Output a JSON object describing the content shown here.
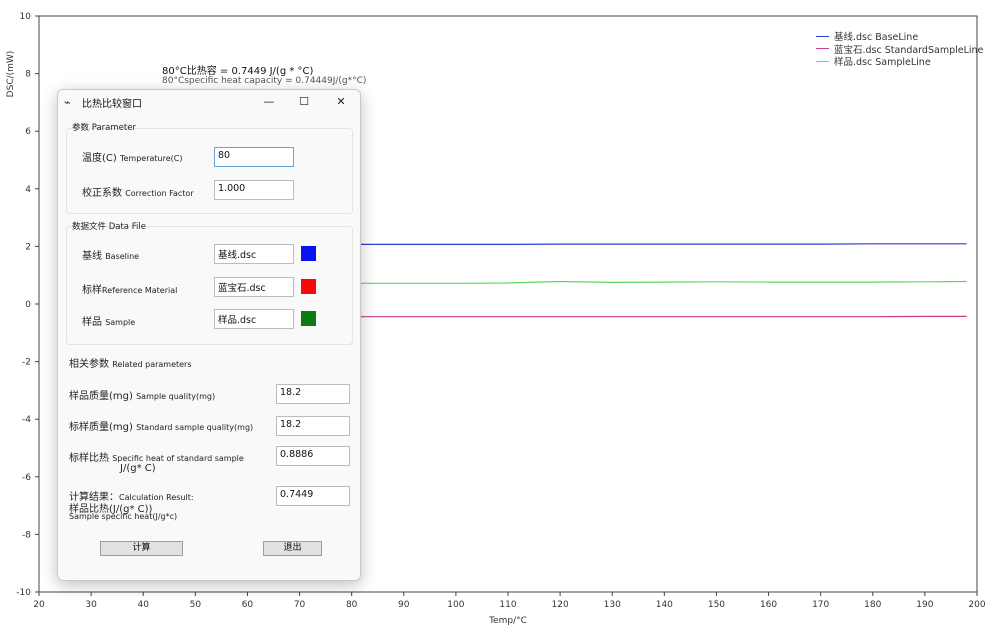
{
  "header": {
    "line1": "80°C比热容 = 0.7449 J/(g * °C)",
    "line2": "80°Cspecific heat capacity = 0.74449J/(g*°C)"
  },
  "chart_data": {
    "type": "line",
    "xlabel": "Temp/°C",
    "ylabel": "DSC/(mW)",
    "xlim": [
      20,
      200
    ],
    "ylim": [
      -10,
      10
    ],
    "xticks": [
      20,
      30,
      40,
      50,
      60,
      70,
      80,
      90,
      100,
      110,
      120,
      130,
      140,
      150,
      160,
      170,
      180,
      190,
      200
    ],
    "yticks": [
      -10,
      -8,
      -6,
      -4,
      -2,
      0,
      2,
      4,
      6,
      8,
      10
    ],
    "legend_position": "top-right",
    "series": [
      {
        "name": "基线.dsc BaseLine",
        "color": "#2b3fd1",
        "x": [
          30,
          40,
          50,
          60,
          70,
          80,
          90,
          100,
          110,
          120,
          130,
          140,
          150,
          160,
          170,
          180,
          190,
          198
        ],
        "y": [
          2.08,
          2.08,
          2.08,
          2.08,
          2.07,
          2.07,
          2.07,
          2.07,
          2.07,
          2.08,
          2.08,
          2.08,
          2.08,
          2.08,
          2.08,
          2.09,
          2.09,
          2.09
        ]
      },
      {
        "name": "蓝宝石.dsc StandardSampleLine",
        "color": "#cc3f86",
        "x": [
          30,
          40,
          50,
          60,
          70,
          80,
          90,
          100,
          110,
          120,
          130,
          140,
          150,
          160,
          170,
          180,
          190,
          198
        ],
        "y": [
          -0.45,
          -0.45,
          -0.45,
          -0.45,
          -0.45,
          -0.44,
          -0.44,
          -0.44,
          -0.44,
          -0.44,
          -0.44,
          -0.44,
          -0.44,
          -0.44,
          -0.44,
          -0.44,
          -0.43,
          -0.43
        ]
      },
      {
        "name": "样品.dsc SampleLine",
        "color": "#5fd85f",
        "x": [
          30,
          40,
          50,
          60,
          70,
          80,
          90,
          100,
          110,
          120,
          130,
          140,
          150,
          160,
          170,
          180,
          190,
          198
        ],
        "y": [
          0.7,
          0.7,
          0.71,
          0.71,
          0.71,
          0.72,
          0.72,
          0.72,
          0.73,
          0.78,
          0.75,
          0.76,
          0.77,
          0.76,
          0.76,
          0.76,
          0.77,
          0.78
        ]
      }
    ]
  },
  "dialog": {
    "title": "比热比较窗口",
    "minimize_icon": "—",
    "maximize_icon": "☐",
    "close_icon": "✕",
    "app_icon": "⌁",
    "param_group": "参数 Parameter",
    "temp_label": "温度(C)",
    "temp_label_en": "Temperature(C)",
    "temp_value": "80",
    "cf_label": "校正系数",
    "cf_label_en": "Correction Factor",
    "cf_value": "1.000",
    "datafile_group": "数据文件 Data File",
    "baseline_label": "基线",
    "baseline_label_en": "Baseline",
    "baseline_value": "基线.dsc",
    "baseline_color": "#0a12f2",
    "ref_label": "标样",
    "ref_label_en": "Reference Material",
    "ref_value": "蓝宝石.dsc",
    "ref_color": "#f50a0a",
    "sample_label": "样品",
    "sample_label_en": "Sample",
    "sample_value": "样品.dsc",
    "sample_color": "#0b7b14",
    "related_label": "相关参数",
    "related_label_en": "Related parameters",
    "sq_label": "样品质量(mg)",
    "sq_label_en": "Sample quality(mg)",
    "sq_value": "18.2",
    "ssq_label": "标样质量(mg)",
    "ssq_label_en": "Standard sample quality(mg)",
    "ssq_value": "18.2",
    "sh_label": "标样比热",
    "sh_label_en": "Specific heat of standard sample",
    "sh_unit": "J/(g* C)",
    "sh_value": "0.8886",
    "calc_label": "计算结果：",
    "calc_label_en": "Calculation Result:",
    "calc_line2": "样品比热(J/(g* C))",
    "calc_line3": "Sample specific heat(J/g*c)",
    "calc_value": "0.7449",
    "compute_button": "计算",
    "exit_button": "退出"
  }
}
